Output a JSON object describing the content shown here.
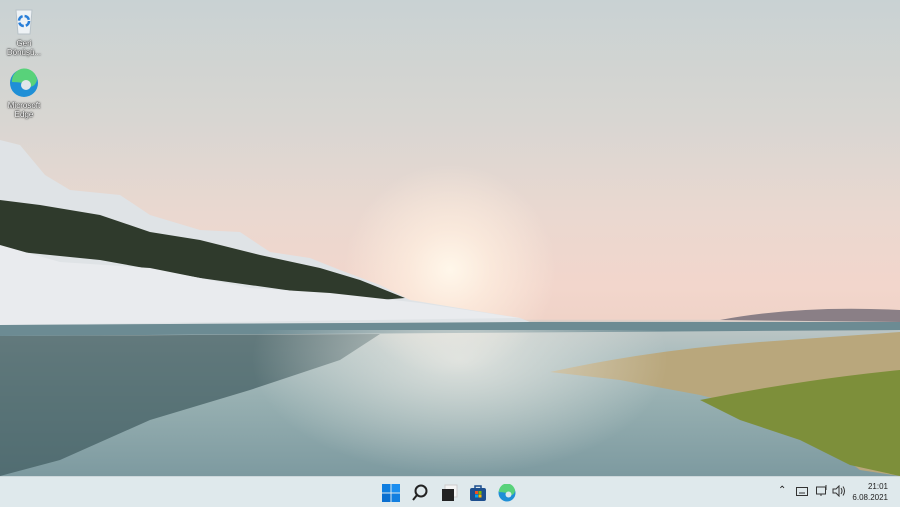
{
  "desktop": {
    "icons": [
      {
        "label": "Geri Dönüşü...",
        "icon": "recycle-bin-icon"
      },
      {
        "label": "Microsoft Edge",
        "icon": "edge-icon"
      }
    ]
  },
  "taskbar": {
    "apps": [
      {
        "name": "Start",
        "icon": "windows-start-icon"
      },
      {
        "name": "Search",
        "icon": "search-icon"
      },
      {
        "name": "Task View",
        "icon": "task-view-icon"
      },
      {
        "name": "Microsoft Store",
        "icon": "store-icon"
      },
      {
        "name": "Microsoft Edge",
        "icon": "edge-icon"
      }
    ],
    "tray": {
      "time": "21:01",
      "date": "6.08.2021"
    }
  },
  "colors": {
    "accent": "#0078d4",
    "taskbar": "#dfe9ec"
  }
}
